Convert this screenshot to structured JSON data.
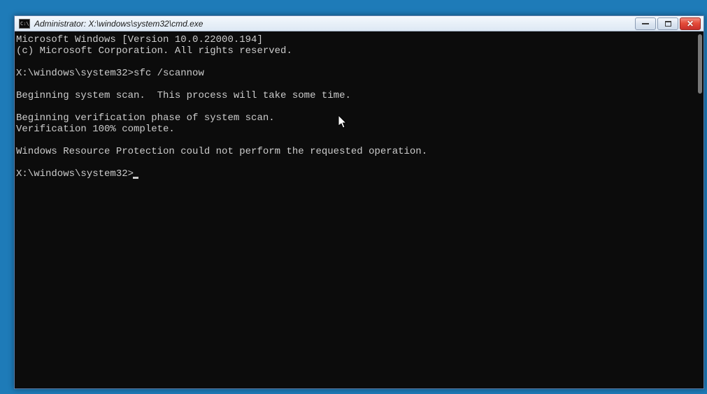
{
  "window": {
    "icon_text": "C:\\",
    "title": "Administrator: X:\\windows\\system32\\cmd.exe"
  },
  "terminal": {
    "lines": [
      "Microsoft Windows [Version 10.0.22000.194]",
      "(c) Microsoft Corporation. All rights reserved.",
      "",
      "X:\\windows\\system32>sfc /scannow",
      "",
      "Beginning system scan.  This process will take some time.",
      "",
      "Beginning verification phase of system scan.",
      "Verification 100% complete.",
      "",
      "Windows Resource Protection could not perform the requested operation.",
      ""
    ],
    "prompt": "X:\\windows\\system32>"
  }
}
